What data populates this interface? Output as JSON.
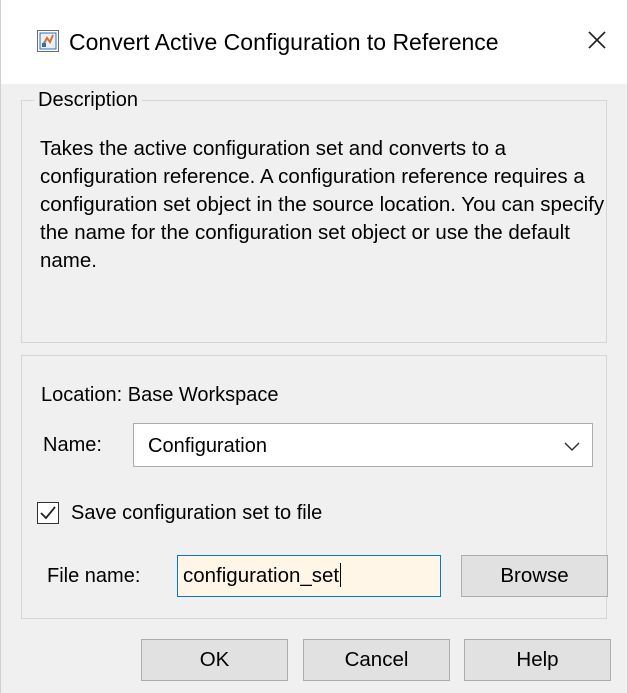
{
  "window": {
    "title": "Convert Active Configuration to Reference",
    "close_glyph": "✕",
    "app_icon": "simulink-model-icon",
    "close_icon": "close-icon"
  },
  "description": {
    "legend": "Description",
    "text": "Takes the active configuration set and converts to a configuration reference. A configuration reference requires a configuration set object in the source location. You can specify the name for the configuration set object or use the default name."
  },
  "configuration": {
    "location_label": "Location: Base Workspace",
    "name_label": "Name:",
    "name_value": "Configuration",
    "save_checkbox": {
      "label": "Save configuration set to file",
      "checked": true
    },
    "file_name_label": "File name:",
    "file_name_value": "configuration_set",
    "browse_label": "Browse"
  },
  "buttons": {
    "ok": "OK",
    "cancel": "Cancel",
    "help": "Help"
  },
  "colors": {
    "input_focus_border": "#0078d7",
    "input_background": "#fff6e8"
  }
}
